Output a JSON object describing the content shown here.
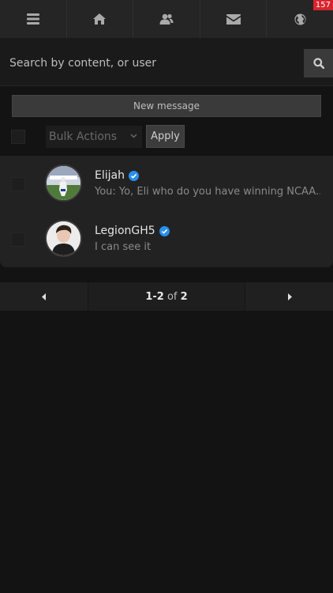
{
  "nav": {
    "items": [
      {
        "icon": "menu-icon"
      },
      {
        "icon": "home-icon"
      },
      {
        "icon": "users-icon"
      },
      {
        "icon": "mail-icon"
      },
      {
        "icon": "globe-icon"
      }
    ],
    "notification_count": "157"
  },
  "search": {
    "placeholder": "Search by content, or user"
  },
  "new_message_label": "New message",
  "bulk": {
    "select_value": "Bulk Actions",
    "apply_label": "Apply"
  },
  "conversations": [
    {
      "name": "Elijah",
      "verified": true,
      "preview": "You: Yo, Eli who do you have winning NCAA..."
    },
    {
      "name": "LegionGH5",
      "verified": true,
      "preview": "I can see it"
    }
  ],
  "pagination": {
    "range": "1-2",
    "of_label": "of",
    "total": "2"
  },
  "colors": {
    "verified": "#2a8ff0",
    "badge": "#d9232d"
  }
}
